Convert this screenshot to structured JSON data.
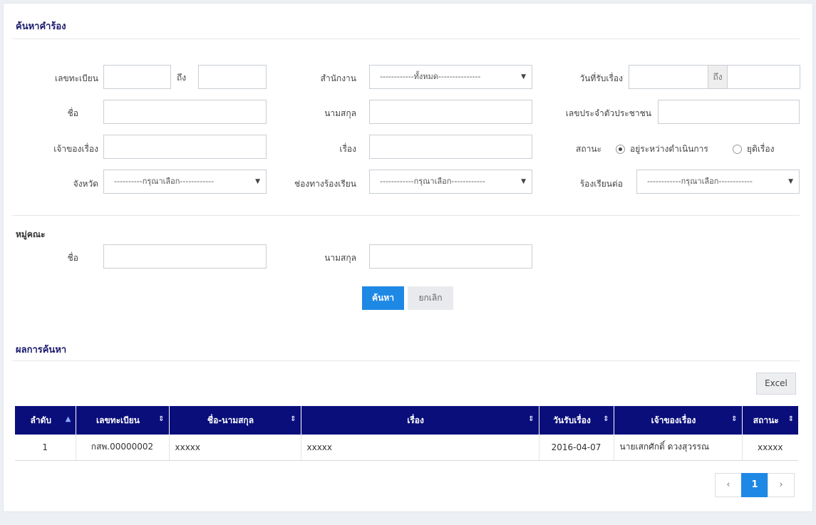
{
  "search": {
    "title": "ค้นหาคำร้อง",
    "reg_no_label": "เลขทะเบียน",
    "to_label": "ถึง",
    "office_label": "สำนักงาน",
    "office_value": "------------ทั้งหมด---------------",
    "received_date_label": "วันที่รับเรื่อง",
    "date_to_label": "ถึง",
    "first_name_label": "ชื่อ",
    "last_name_label": "นามสกุล",
    "citizen_id_label": "เลขประจำตัวประชาชน",
    "owner_label": "เจ้าของเรื่อง",
    "subject_label": "เรื่อง",
    "status_label": "สถานะ",
    "status_options": [
      "อยู่ระหว่างดำเนินการ",
      "ยุติเรื่อง"
    ],
    "province_label": "จังหวัด",
    "province_value": "----------กรุณาเลือก------------",
    "channel_label": "ช่องทางร้องเรียน",
    "channel_value": "------------กรุณาเลือก------------",
    "forward_label": "ร้องเรียนต่อ",
    "forward_value": "------------กรุณาเลือก------------"
  },
  "group": {
    "title": "หมู่คณะ",
    "first_name_label": "ชื่อ",
    "last_name_label": "นามสกุล"
  },
  "actions": {
    "search_label": "ค้นหา",
    "cancel_label": "ยกเลิก"
  },
  "results": {
    "title": "ผลการค้นหา",
    "excel_label": "Excel",
    "columns": [
      "ลำดับ",
      "เลขทะเบียน",
      "ชื่อ-นามสกุล",
      "เรื่อง",
      "วันรับเรื่อง",
      "เจ้าของเรื่อง",
      "สถานะ"
    ],
    "rows": [
      [
        "1",
        "กสพ.00000002",
        "xxxxx",
        "xxxxx",
        "2016-04-07",
        "นายเสกศักดิ์ ดวงสุวรรณ",
        "xxxxx"
      ]
    ]
  },
  "pagination": {
    "prev": "‹",
    "current": "1",
    "next": "›"
  },
  "colors": {
    "header_bg": "#0a0e7a",
    "primary": "#1e88e5",
    "title": "#1a1a6e"
  }
}
